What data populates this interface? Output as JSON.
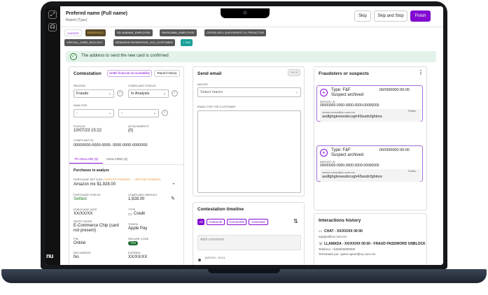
{
  "header": {
    "name": "Prefered name (Full name)",
    "report_type": "Report (Type)",
    "skip": "Skip",
    "skip_stop": "Skip and Stop",
    "finish": "Finish"
  },
  "tags": [
    "CLIENTE",
    "ENDEREÇO",
    "SD-NUBANK_EMPLOYEE",
    "PAYROAMU_EMPLOYEE",
    "CROSS-SELL-EASYINVEST-V1-PROACTIVE",
    "VIRTUAL_CARD_ROLLOUT",
    "REWARDS-PAYMENTMS_OLD_CUSTOMER",
    "+ TAG"
  ],
  "banner": "The address to send the new card is confirmed",
  "contestation": {
    "title": "Contestation",
    "settle": "Settle financial accountability",
    "history": "Report history",
    "reason_label": "REASON",
    "reason_value": "Fraude",
    "status_label": "COMPLAINT STATUS",
    "status_value": "In Analysis",
    "analysis_label": "ANALYSIS",
    "analysis_a": "-",
    "analysis_b": "-",
    "filed_label": "FILED AT",
    "filed_value": "10/07/23  15:22",
    "attach_label": "ATTACHMENTS",
    "attach_value": "(0)",
    "cid_label": "COMPLAINT ID",
    "cid_value": "00000000-0000-0000- 0000-0000-0000000",
    "tab_to_analyze": "TO ANALYZE (3)",
    "tab_analyzed": "ANALYZED (2)",
    "purchases_title": "Purchases to analyze",
    "purchase_settled": "PURCHASE SETTLED",
    "dispute_pending": "• DISPUTE PENDING",
    "refund_pending": "• REFUND PENDING",
    "merchant": "Amazon mx  $1,928.00",
    "pstatus_label": "PURCHASE STATUS",
    "pstatus_value": "Settled",
    "amount_label": "COMPLAINT AMOUNT",
    "amount_value": "1,928.00",
    "pdate_label": "PURCHASE DATE",
    "pdate_value": "XX/XX/XX",
    "type_label": "TYPE",
    "type_value": "Credit",
    "entry_label": "ENTRY MODE",
    "entry_value": "E-Commerce Chip (card not present)",
    "token_label": "TOKEN",
    "token_value": "Apple Pay",
    "pin_label": "PIN",
    "pin_value": "Online",
    "secure_label": "SECURE CODE",
    "secure_value": "Yes",
    "recurrent_label": "RECURRENT",
    "recurrent_value": "No",
    "expired_label": "EXPIRED",
    "expired_value": "XX/XX/XX"
  },
  "email": {
    "title": "Send email",
    "send": "Send",
    "macro_label": "MACRO",
    "macro_placeholder": "Select macro",
    "customer_label": "EMAIL FOR THE CUSTOMER"
  },
  "timeline": {
    "title": "Contestation timeline",
    "filters": [
      "All",
      "Customer",
      "Comments",
      "Automatic"
    ],
    "comment_placeholder": "Add comment",
    "entry_time": "10/07/23 - 20:13"
  },
  "fraudsters": {
    "title": "Fraudsters or suspects",
    "cards": [
      {
        "type": "Type: F&F",
        "status": "Suspect archived",
        "amount": "00/00/0000  00:00",
        "report_label": "REPORT ID",
        "report_value": "00000000-0000-0000-0000-00000000",
        "email": "xxxxxx.xxxxx@nu.com.mx",
        "public": "Public",
        "key": "asdfghgtrewsdxcvgtr43wsdcfghtres"
      },
      {
        "type": "Type: F&F",
        "status": "Suspect archived",
        "amount": "00/00/0000  00:00",
        "report_label": "REPORT ID",
        "report_value": "00000000-0000-0000-0000-00000000",
        "email": "xxxxxx.xxxxx@nu.com.mx",
        "public": "Public",
        "key": "asdfghgtrewsdxcvgtr43wsdcfghtres"
      }
    ]
  },
  "interactions": {
    "title": "Interactions history",
    "chat": "CHAT - XX/XX/XX  00:00",
    "chat_email": "equipo@nu.com.mx",
    "call": "LLAMADA - XX/XX/XX  00:00 - FRAUD PASSWORD UNBLOCK",
    "phone": "Telefono: +525500000000",
    "ended": "Terminado por: xpeer.xpeer@nu.com.mx"
  },
  "rail": {
    "logo": "nu"
  },
  "colors": {
    "accent": "#820ad1",
    "success_bg": "#e3f3ea",
    "tag_gray": "#555555"
  }
}
